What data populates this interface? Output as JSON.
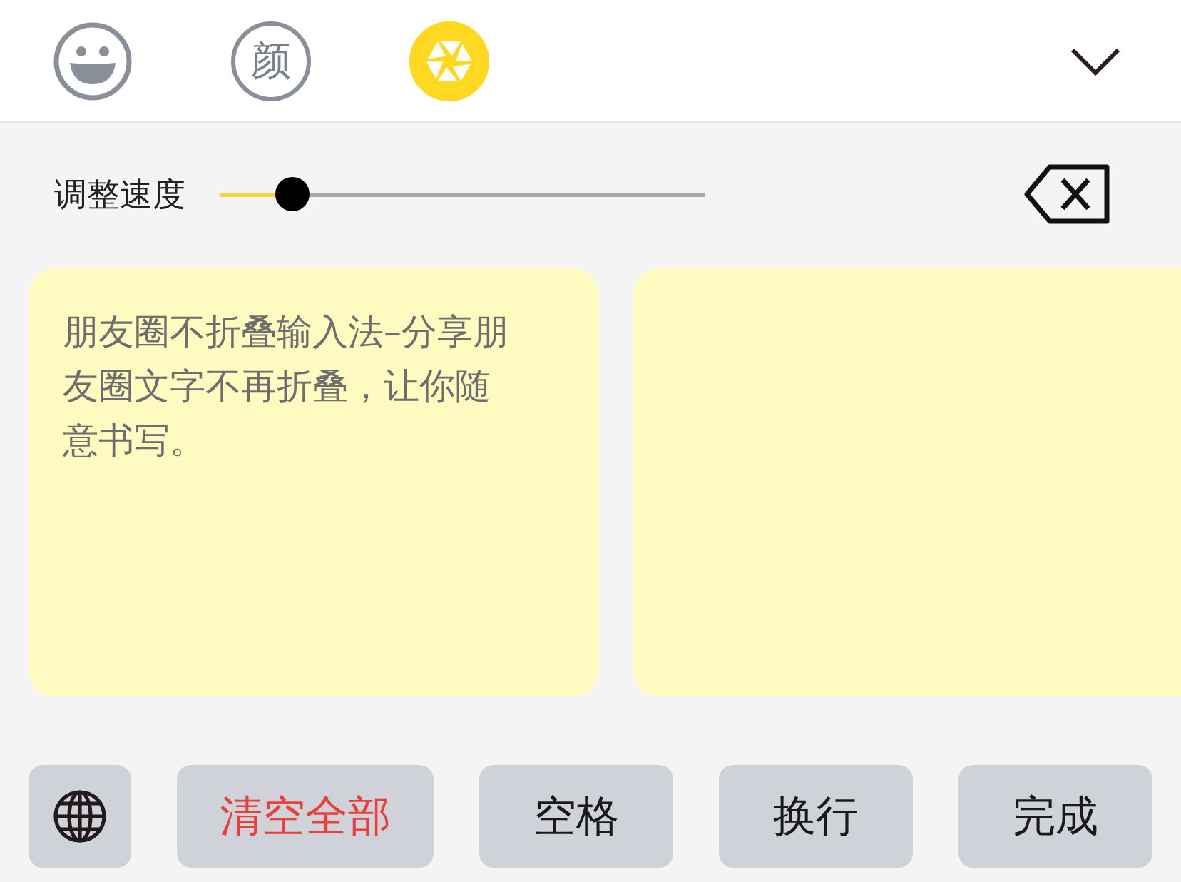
{
  "tabs": [
    {
      "kind": "emoji",
      "selected": false
    },
    {
      "kind": "text",
      "label": "颜",
      "selected": false
    },
    {
      "kind": "aperture",
      "selected": true
    }
  ],
  "speed": {
    "label": "调整速度",
    "level": 0.15
  },
  "cards": [
    {
      "kind": "phrase",
      "lines": [
        "朋友圈不折叠输入法–分享朋",
        "友圈文字不再折叠，让你随",
        "意书写。"
      ]
    },
    {
      "kind": "blank"
    }
  ],
  "keys": [
    {
      "kind": "globe"
    },
    {
      "kind": "danger",
      "label": "清空全部"
    },
    {
      "kind": "plain",
      "label": "空格"
    },
    {
      "kind": "plain",
      "label": "换行"
    },
    {
      "kind": "plain",
      "label": "完成"
    }
  ]
}
